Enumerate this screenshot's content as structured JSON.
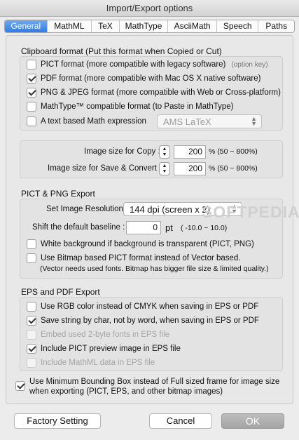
{
  "window": {
    "title": "Import/Export options"
  },
  "tabs": [
    {
      "label": "General",
      "active": true
    },
    {
      "label": "MathML"
    },
    {
      "label": "TeX"
    },
    {
      "label": "MathType"
    },
    {
      "label": "AsciiMath"
    },
    {
      "label": "Speech"
    },
    {
      "label": "Paths"
    }
  ],
  "clipboard": {
    "title": "Clipboard format (Put this format when Copied or Cut)",
    "options": [
      {
        "label": "PICT format (more compatible with legacy software)",
        "checked": false,
        "hint": "(option key)"
      },
      {
        "label": "PDF format (more compatible with Mac OS X native software)",
        "checked": true
      },
      {
        "label": "PNG & JPEG format (more compatible with Web or Cross-platform)",
        "checked": true
      },
      {
        "label": "MathType™ compatible format (to Paste in MathType)",
        "checked": false
      },
      {
        "label": "A text based Math expression",
        "checked": false
      }
    ],
    "math_expression_select": {
      "value": "AMS LaTeX"
    }
  },
  "image_size": {
    "copy": {
      "label": "Image size for Copy :",
      "value": "200",
      "unit": "% (50 ~ 800%)"
    },
    "save": {
      "label": "Image size for Save & Convert :",
      "value": "200",
      "unit": "% (50 ~ 800%)"
    }
  },
  "pict_png": {
    "title": "PICT & PNG Export",
    "resolution_label": "Set Image Resolution :",
    "resolution_value": "144 dpi (screen x 2)",
    "baseline_label": "Shift the default baseline :",
    "baseline_value": "0",
    "baseline_unit": "pt",
    "baseline_range": "( -10.0 ~ 10.0)",
    "options": [
      {
        "label": "White background if background is transparent (PICT, PNG)",
        "checked": false
      },
      {
        "label": "Use Bitmap based PICT format instead of Vector based.",
        "checked": false
      }
    ],
    "note": "(Vector needs used fonts. Bitmap has bigger file size & limited quality.)"
  },
  "eps_pdf": {
    "title": "EPS and PDF Export",
    "options": [
      {
        "label": "Use RGB color instead of CMYK when saving in EPS or PDF",
        "checked": false,
        "disabled": false
      },
      {
        "label": "Save string by char, not by word, when saving in EPS or PDF",
        "checked": true,
        "disabled": false
      },
      {
        "label": "Embed used 2-byte fonts in EPS file",
        "checked": false,
        "disabled": true
      },
      {
        "label": "Include PICT preview image in EPS file",
        "checked": true,
        "disabled": false
      },
      {
        "label": "Include MathML data in EPS file",
        "checked": false,
        "disabled": true
      }
    ]
  },
  "bounding_box": {
    "label_line1": "Use Minimum Bounding Box instead of Full sized frame for image size",
    "label_line2": "when exporting (PICT, EPS, and other bitmap images)",
    "checked": true
  },
  "buttons": {
    "factory": "Factory Setting",
    "cancel": "Cancel",
    "ok": "OK"
  },
  "watermark": "SOFTPEDIA",
  "colors": {
    "accent": "#2f7de6",
    "ok_button": "#adadad"
  }
}
